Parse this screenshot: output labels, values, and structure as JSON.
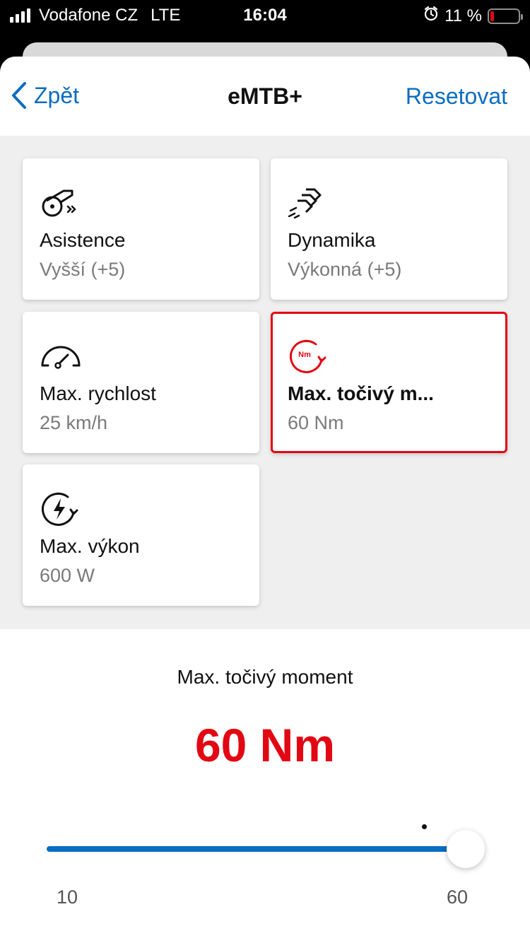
{
  "status_bar": {
    "carrier": "Vodafone CZ",
    "network": "LTE",
    "time": "16:04",
    "battery_percent": "11 %",
    "battery_level": 0.11
  },
  "nav": {
    "back_label": "Zpět",
    "title": "eMTB+",
    "reset_label": "Resetovat"
  },
  "cards": [
    {
      "icon": "assist-icon",
      "title": "Asistence",
      "value": "Vyšší (+5)"
    },
    {
      "icon": "dynamics-icon",
      "title": "Dynamika",
      "value": "Výkonná (+5)"
    },
    {
      "icon": "speedometer-icon",
      "title": "Max. rychlost",
      "value": "25 km/h"
    },
    {
      "icon": "torque-icon",
      "title": "Max. točivý m...",
      "value": "60 Nm",
      "selected": true
    },
    {
      "icon": "power-icon",
      "title": "Max. výkon",
      "value": "600 W"
    }
  ],
  "detail": {
    "label": "Max. točivý moment",
    "value": "60 Nm",
    "slider": {
      "min": "10",
      "max": "60",
      "min_value": 10,
      "max_value": 60,
      "current": 60
    }
  },
  "colors": {
    "accent_blue": "#0a6dc0",
    "accent_red": "#e30613"
  }
}
